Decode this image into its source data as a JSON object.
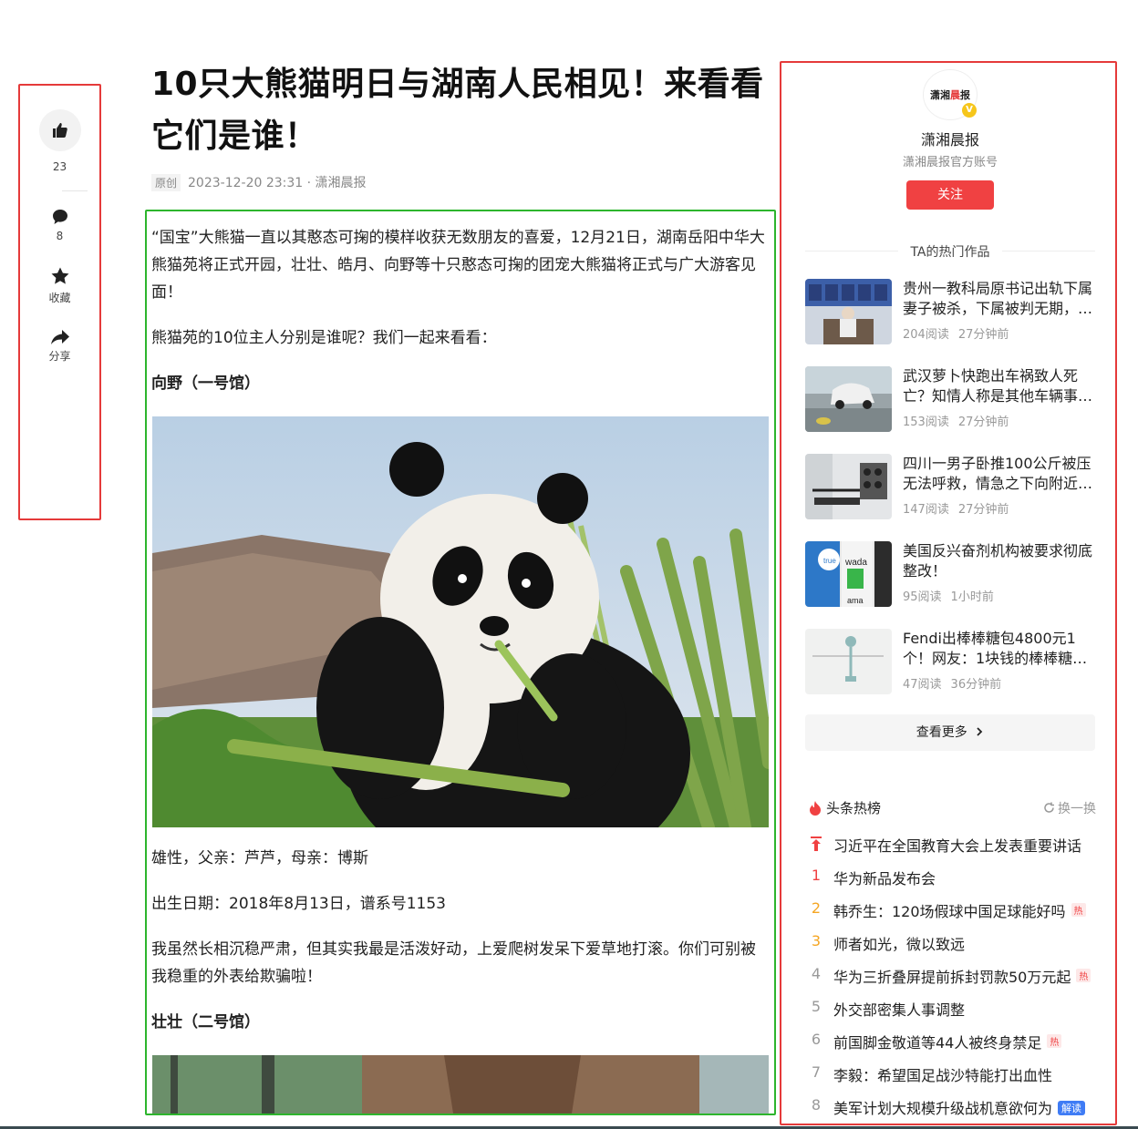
{
  "actions": {
    "like_count": "23",
    "comment_count": "8",
    "favorite_label": "收藏",
    "share_label": "分享"
  },
  "article": {
    "title": "10只大熊猫明日与湖南人民相见！来看看它们是谁！",
    "tag": "原创",
    "meta": "2023-12-20 23:31 · 潇湘晨报",
    "p1": "“国宝”大熊猫一直以其憨态可掬的模样收获无数朋友的喜爱，12月21日，湖南岳阳中华大熊猫苑将正式开园，壮壮、皓月、向野等十只憨态可掬的团宠大熊猫将正式与广大游客见面！",
    "p2": "熊猫苑的10位主人分别是谁呢？我们一起来看看：",
    "sub1": "向野（一号馆）",
    "p3": "雄性，父亲：芦芦，母亲：博斯",
    "p4": "出生日期：2018年8月13日，谱系号1153",
    "p5": "我虽然长相沉稳严肃，但其实我最是活泼好动，上爱爬树发呆下爱草地打滚。你们可别被我稳重的外表给欺骗啦！",
    "sub2": "壮壮（二号馆）"
  },
  "author": {
    "logo_text_a": "潇湘",
    "logo_text_b": "晨",
    "logo_text_c": "报",
    "verified": "V",
    "name": "潇湘晨报",
    "desc": "潇湘晨报官方账号",
    "follow_label": "关注"
  },
  "hot_works": {
    "heading": "TA的热门作品",
    "items": [
      {
        "title": "贵州一教科局原书记出轨下属妻子被杀，下属被判无期，…",
        "reads": "204阅读",
        "time": "27分钟前"
      },
      {
        "title": "武汉萝卜快跑出车祸致人死亡？知情人称是其他车辆事…",
        "reads": "153阅读",
        "time": "27分钟前"
      },
      {
        "title": "四川一男子卧推100公斤被压无法呼救，情急之下向附近…",
        "reads": "147阅读",
        "time": "27分钟前"
      },
      {
        "title": "美国反兴奋剂机构被要求彻底整改！",
        "reads": "95阅读",
        "time": "1小时前"
      },
      {
        "title": "Fendi出棒棒糖包4800元1个！网友：1块钱的棒棒糖…",
        "reads": "47阅读",
        "time": "36分钟前"
      }
    ],
    "thumb_text_4a": "true",
    "thumb_text_4b": "wada",
    "thumb_text_4c": "ama",
    "more_label": "查看更多"
  },
  "trending": {
    "title": "头条热榜",
    "refresh_label": "换一换",
    "items": [
      {
        "rank": "",
        "text": "习近平在全国教育大会上发表重要讲话",
        "badge": ""
      },
      {
        "rank": "1",
        "text": "华为新品发布会",
        "badge": ""
      },
      {
        "rank": "2",
        "text": "韩乔生：120场假球中国足球能好吗",
        "badge": "热"
      },
      {
        "rank": "3",
        "text": "师者如光，微以致远",
        "badge": ""
      },
      {
        "rank": "4",
        "text": "华为三折叠屏提前拆封罚款50万元起",
        "badge": "热"
      },
      {
        "rank": "5",
        "text": "外交部密集人事调整",
        "badge": ""
      },
      {
        "rank": "6",
        "text": "前国脚金敬道等44人被终身禁足",
        "badge": "热"
      },
      {
        "rank": "7",
        "text": "李毅：希望国足战沙特能打出血性",
        "badge": ""
      },
      {
        "rank": "8",
        "text": "美军计划大规模升级战机意欲何为",
        "badge": "解读"
      }
    ]
  },
  "colors": {
    "annotation_red": "#e53a3a",
    "annotation_green": "#2db52d",
    "follow_button": "#f04142",
    "rank_top": "#f04142",
    "rank_mid": "#f5a623",
    "badge_blue": "#3f7cf5"
  },
  "icons": [
    "thumbs-up-icon",
    "comment-icon",
    "star-icon",
    "share-icon",
    "fire-icon",
    "refresh-icon",
    "pin-top-icon",
    "chevron-right-icon"
  ]
}
